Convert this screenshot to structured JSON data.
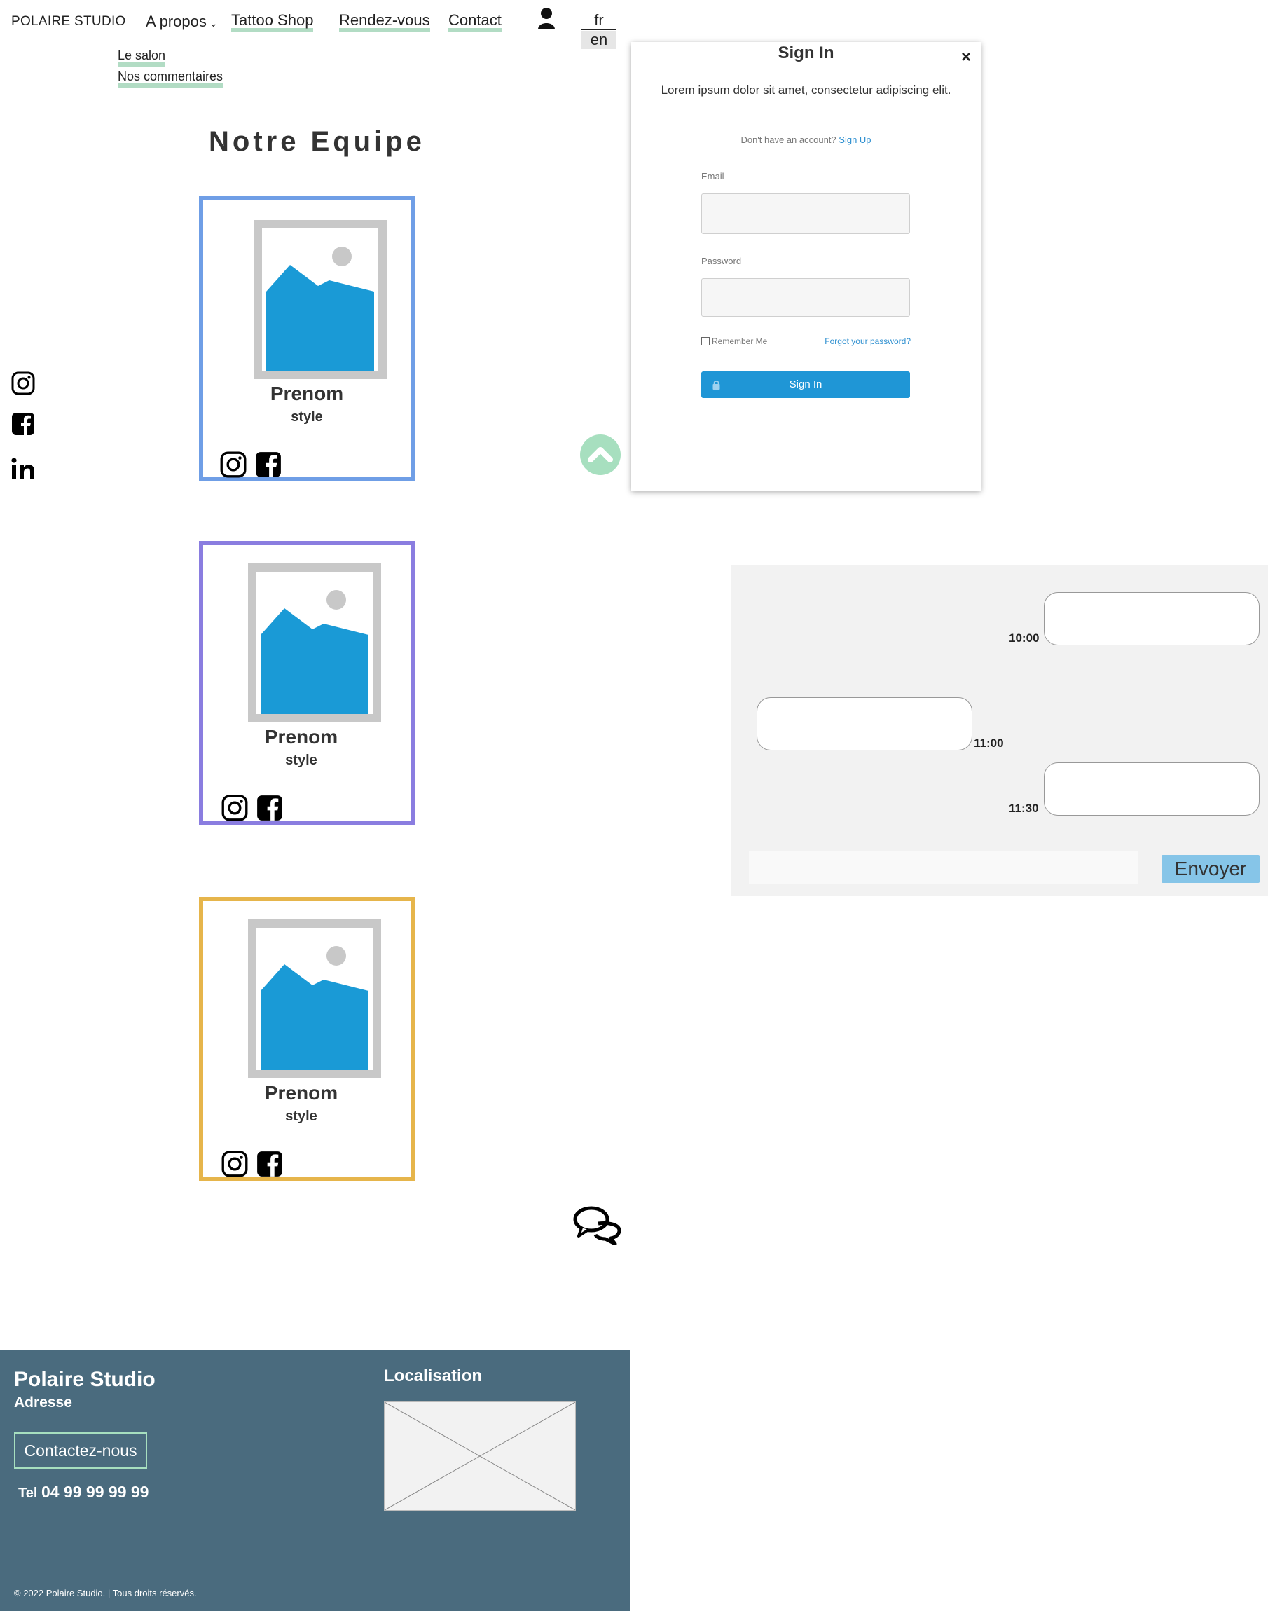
{
  "nav": {
    "brand": "POLAIRE STUDIO",
    "items": [
      {
        "label": "A propos"
      },
      {
        "label": "Tattoo Shop"
      },
      {
        "label": "Rendez-vous"
      },
      {
        "label": "Contact"
      }
    ],
    "submenu": [
      "Le salon",
      "Nos commentaires"
    ],
    "languages": [
      "fr",
      "en"
    ]
  },
  "section": {
    "title": "Notre Equipe"
  },
  "cards": [
    {
      "name": "Prenom",
      "style": "style",
      "border_color": "#6f9ee6"
    },
    {
      "name": "Prenom",
      "style": "style",
      "border_color": "#8a7de0"
    },
    {
      "name": "Prenom",
      "style": "style",
      "border_color": "#e6b54b"
    }
  ],
  "signin": {
    "title": "Sign In",
    "close": "×",
    "description": "Lorem ipsum dolor sit amet, consectetur adipiscing elit.",
    "no_account": "Don't have an account?",
    "signup_link": "Sign Up",
    "email_label": "Email",
    "password_label": "Password",
    "remember_label": "Remember Me",
    "forgot_label": "Forgot your password?",
    "button_label": "Sign In"
  },
  "chat": {
    "messages": [
      {
        "time": "10:00",
        "side": "right"
      },
      {
        "time": "11:00",
        "side": "left"
      },
      {
        "time": "11:30",
        "side": "right"
      }
    ],
    "send_label": "Envoyer"
  },
  "footer": {
    "title": "Polaire Studio",
    "address": "Adresse",
    "contact_button": "Contactez-nous",
    "tel_label": "Tel",
    "tel_number": "04 99 99 99 99",
    "location_title": "Localisation",
    "copyright": "© 2022 Polaire Studio. | Tous droits réservés."
  },
  "colors": {
    "accent_underline": "#b2dcc4",
    "footer_bg": "#4a6b7e",
    "primary_blue": "#1f96d6",
    "send_button": "#86c5e8"
  }
}
